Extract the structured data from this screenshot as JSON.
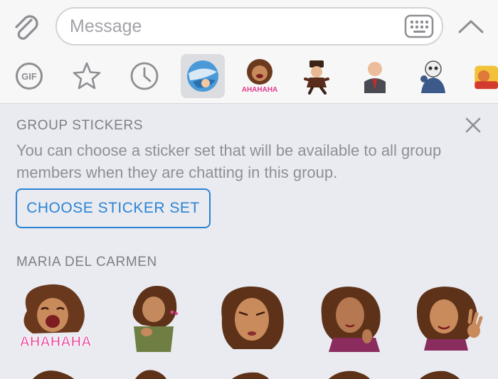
{
  "composer": {
    "placeholder": "Message"
  },
  "tabs": [
    {
      "name": "gif",
      "label": "GIF"
    },
    {
      "name": "favorites"
    },
    {
      "name": "recent"
    },
    {
      "name": "group-sticker-set",
      "active": true
    },
    {
      "name": "maria-del-carmen-set",
      "label": "AHAHAHA"
    },
    {
      "name": "sticker-set-2"
    },
    {
      "name": "sticker-set-3"
    },
    {
      "name": "sticker-set-4"
    },
    {
      "name": "sticker-set-5"
    }
  ],
  "group_stickers": {
    "title": "GROUP STICKERS",
    "description": "You can choose a sticker set that will be available to all group members when they are chatting in this group.",
    "button_label": "CHOOSE STICKER SET"
  },
  "sticker_set": {
    "title": "MARIA DEL CARMEN",
    "first_sticker_caption": "AHAHAHA"
  },
  "colors": {
    "accent": "#2b83d4",
    "panel_background": "#e9ebf0",
    "header_text": "#7c7f85"
  }
}
